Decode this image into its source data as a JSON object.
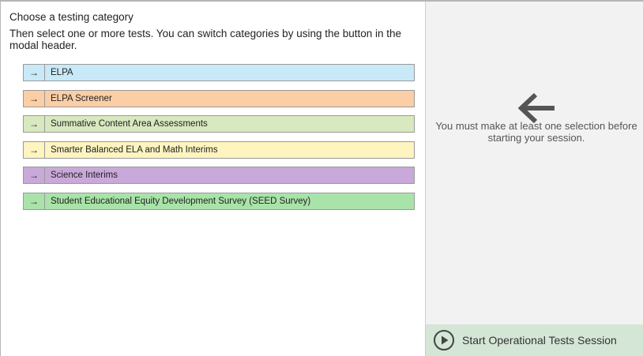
{
  "left": {
    "heading": "Choose a testing category",
    "subheading": "Then select one or more tests. You can switch categories by using the button in the modal header.",
    "categories": [
      {
        "arrow": "→",
        "label": "ELPA",
        "color": "#c8e9f7"
      },
      {
        "arrow": "→",
        "label": "ELPA Screener",
        "color": "#fbcea6"
      },
      {
        "arrow": "→",
        "label": "Summative Content Area Assessments",
        "color": "#d8e8bf"
      },
      {
        "arrow": "→",
        "label": "Smarter Balanced ELA and Math Interims",
        "color": "#fdf4c0"
      },
      {
        "arrow": "→",
        "label": "Science Interims",
        "color": "#c9a9d9"
      },
      {
        "arrow": "→",
        "label": "Student Educational Equity Development Survey (SEED Survey)",
        "color": "#a9e3a9"
      }
    ]
  },
  "right": {
    "arrow_icon": "arrow-left-icon",
    "message": "You must make at least one selection before starting your session.",
    "start_icon": "play-circle-icon",
    "start_label": "Start Operational Tests Session",
    "start_bg": "#d4e6d6"
  }
}
